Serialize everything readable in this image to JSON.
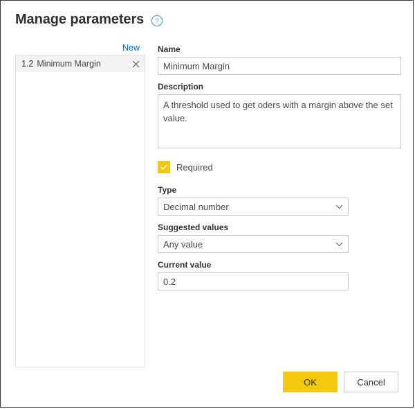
{
  "dialog": {
    "title": "Manage parameters",
    "help_icon": "help-circle-icon"
  },
  "left_pane": {
    "new_label": "New",
    "items": [
      {
        "type_icon": "1.2",
        "label": "Minimum Margin",
        "remove_icon": "close-icon"
      }
    ]
  },
  "form": {
    "name": {
      "label": "Name",
      "value": "Minimum Margin",
      "placeholder": ""
    },
    "description": {
      "label": "Description",
      "value": "A threshold used to get oders with a margin above the set value.",
      "placeholder": ""
    },
    "required": {
      "label": "Required",
      "checked": true,
      "check_icon": "checkmark-icon"
    },
    "type": {
      "label": "Type",
      "value": "Decimal number",
      "chevron_icon": "chevron-down-icon"
    },
    "suggested_values": {
      "label": "Suggested values",
      "value": "Any value",
      "chevron_icon": "chevron-down-icon"
    },
    "current_value": {
      "label": "Current value",
      "value": "0.2",
      "placeholder": ""
    }
  },
  "footer": {
    "ok_label": "OK",
    "cancel_label": "Cancel"
  },
  "colors": {
    "accent_yellow": "#F2C811",
    "link_blue": "#0F6CBD",
    "text_dark": "#323130",
    "border_gray": "#C8C6C4"
  }
}
